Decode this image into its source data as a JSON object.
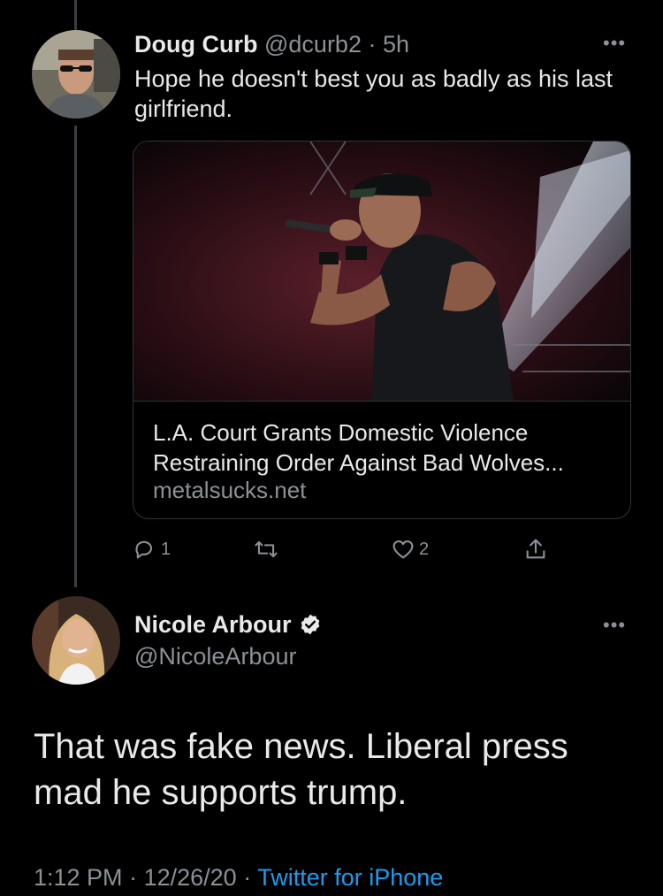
{
  "tweet1": {
    "display_name": "Doug Curb",
    "handle": "@dcurb2",
    "separator": "·",
    "time": "5h",
    "text": "Hope he doesn't best you as badly as his last girlfriend.",
    "more_glyph": "•••",
    "card": {
      "title": "L.A. Court Grants Domestic Violence Restraining Order Against Bad Wolves...",
      "domain": "metalsucks.net"
    },
    "actions": {
      "reply_count": "1",
      "retweet_count": "",
      "like_count": "2"
    }
  },
  "tweet2": {
    "display_name": "Nicole Arbour",
    "handle": "@NicoleArbour",
    "more_glyph": "•••",
    "text": "That was fake news. Liberal press mad he supports trump.",
    "time": "1:12 PM",
    "sep1": "·",
    "date": "12/26/20",
    "sep2": "·",
    "source": "Twitter for iPhone"
  },
  "colors": {
    "background": "#000000",
    "text": "#e7e9ea",
    "muted": "#8b9197",
    "link": "#1d9bf0",
    "border": "#2f3336"
  },
  "icons": [
    "reply-icon",
    "retweet-icon",
    "like-icon",
    "share-icon",
    "verified-badge-icon",
    "more-icon"
  ]
}
